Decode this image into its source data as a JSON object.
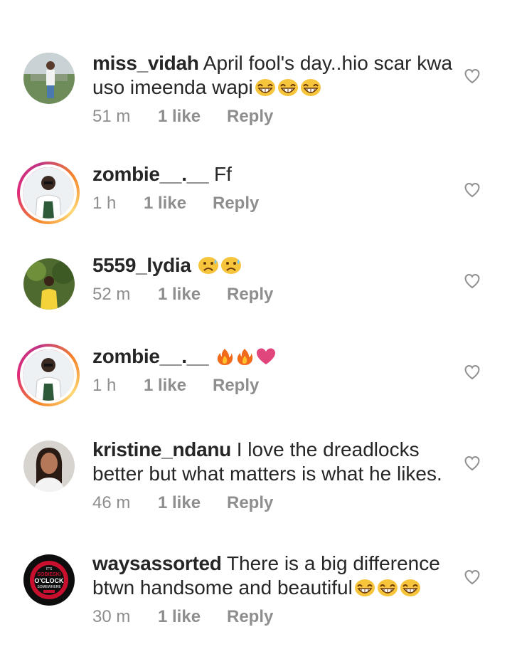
{
  "comments": [
    {
      "username": "miss_vidah",
      "text": "April fool's day..hio scar kwa uso imeenda wapi",
      "emoji": [
        "grin-sweat-emoji",
        "grin-sweat-emoji",
        "grin-sweat-emoji"
      ],
      "time": "51 m",
      "likes": "1 like",
      "reply": "Reply",
      "story_ring": false
    },
    {
      "username": "zombie__.__",
      "text": "Ff",
      "emoji": [],
      "time": "1 h",
      "likes": "1 like",
      "reply": "Reply",
      "story_ring": true
    },
    {
      "username": "5559_lydia",
      "text": "",
      "emoji": [
        "sad-sweat-emoji",
        "sad-sweat-emoji"
      ],
      "time": "52 m",
      "likes": "1 like",
      "reply": "Reply",
      "story_ring": false
    },
    {
      "username": "zombie__.__",
      "text": "",
      "emoji": [
        "fire-emoji",
        "fire-emoji",
        "heart-emoji"
      ],
      "time": "1 h",
      "likes": "1 like",
      "reply": "Reply",
      "story_ring": true
    },
    {
      "username": "kristine_ndanu",
      "text": "I love the dreadlocks better but what matters is what he likes.",
      "emoji": [],
      "time": "46 m",
      "likes": "1 like",
      "reply": "Reply",
      "story_ring": false
    },
    {
      "username": "waysassorted",
      "text": "There is a big difference btwn handsome and beautiful",
      "emoji": [
        "grin-sweat-emoji",
        "grin-sweat-emoji",
        "grin-sweat-emoji"
      ],
      "time": "30 m",
      "likes": "1 like",
      "reply": "Reply",
      "story_ring": false,
      "avatar_text": [
        "IT'S",
        "SOBIESKI",
        "O'CLOCK",
        "SOMEWHERE"
      ]
    }
  ],
  "colors": {
    "primary_text": "#262626",
    "secondary_text": "#8e8e8e",
    "heart_outline": "#8e8e8e"
  }
}
